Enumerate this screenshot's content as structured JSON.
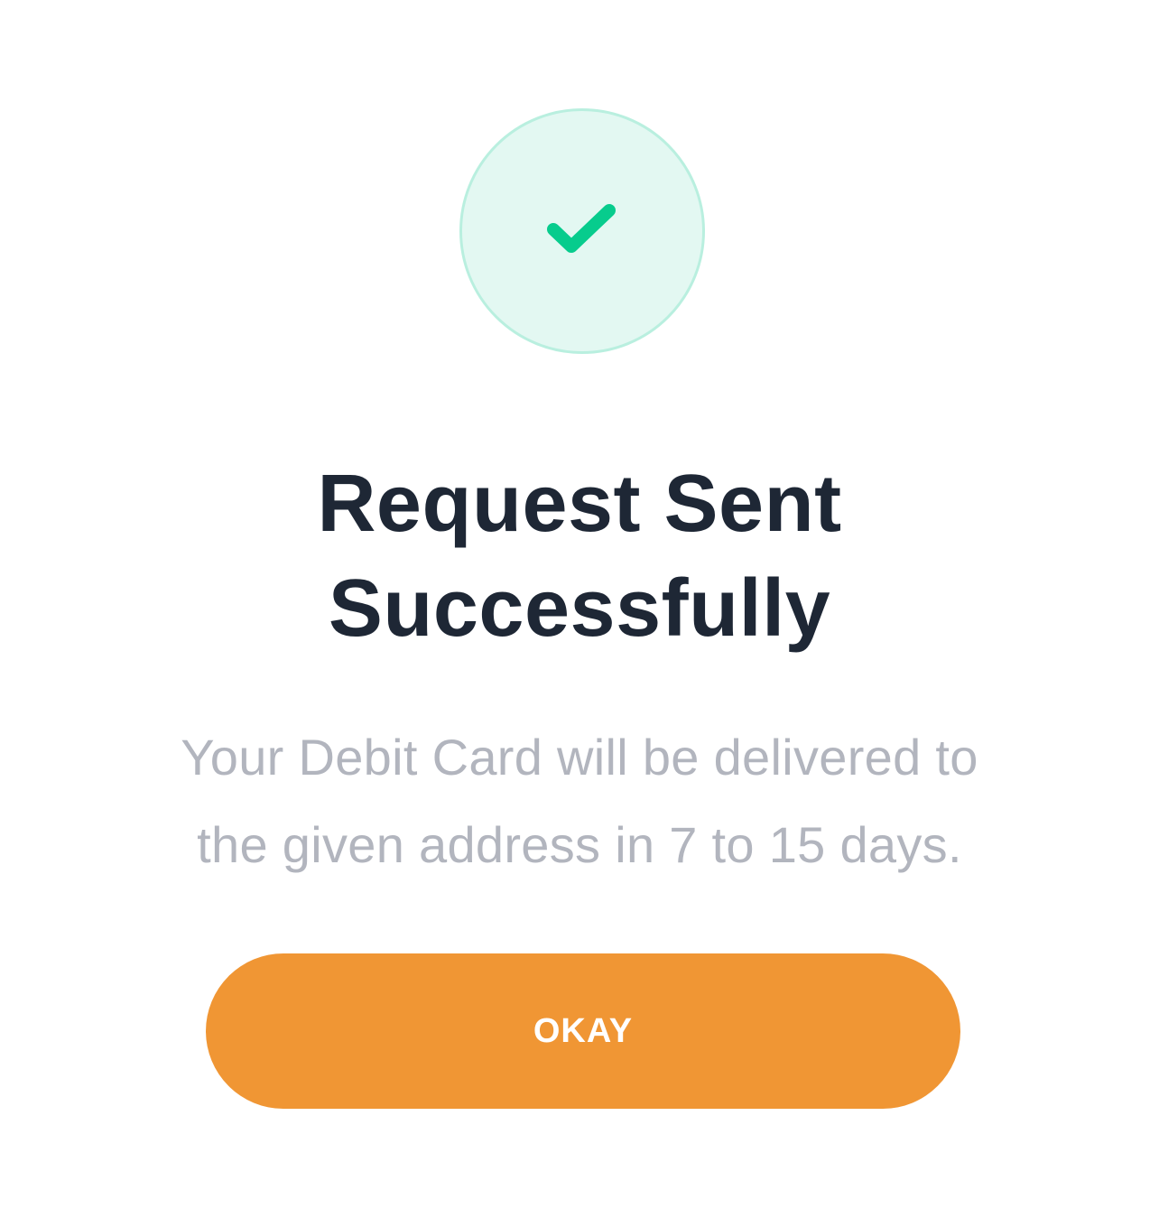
{
  "success": {
    "icon": "checkmark-icon",
    "circle_fill": "#e3f8f2",
    "circle_border": "#b9efdf",
    "check_color": "#07cc8d"
  },
  "title": {
    "line1": "Request Sent",
    "line2": "Successfully"
  },
  "message": {
    "line1": "Your Debit Card will be delivered to",
    "line2": "the given address in 7 to 15 days."
  },
  "button": {
    "label": "OKAY",
    "color": "#f09634"
  }
}
